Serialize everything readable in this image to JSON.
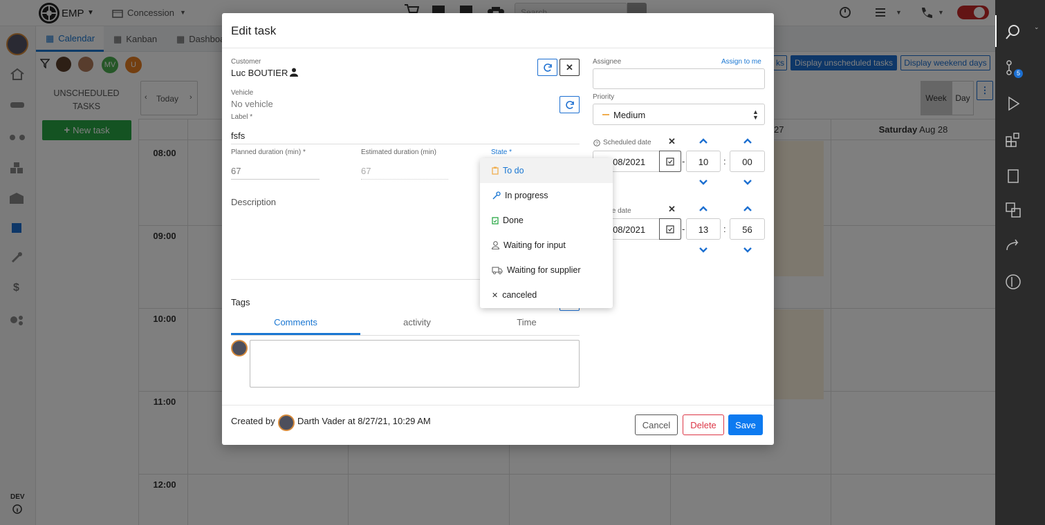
{
  "topbar": {
    "app_name": "EMP",
    "location": "Concession",
    "search_placeholder": "Search"
  },
  "view_tabs": [
    {
      "label": "Calendar",
      "icon": "calendar-icon"
    },
    {
      "label": "Kanban",
      "icon": "kanban-icon"
    },
    {
      "label": "Dashboa",
      "icon": "dashboard-icon"
    }
  ],
  "filter_avatars": [
    "MV",
    "U"
  ],
  "avatar_colors": {
    "MV": "#4caf50",
    "U": "#e67e22"
  },
  "unscheduled": {
    "title": "UNSCHEDULED TASKS",
    "new_task_label": "New task"
  },
  "nav": {
    "today": "Today",
    "week": "Week",
    "day": "Day"
  },
  "toolbar_buttons": {
    "tasks_fragment": "ks",
    "display_unscheduled": "Display unscheduled tasks",
    "display_weekend": "Display weekend days"
  },
  "calendar": {
    "day_header_fragment": "27",
    "saturday_label": "Saturday",
    "saturday_date": "Aug 28",
    "hours": [
      "08:00",
      "09:00",
      "10:00",
      "11:00",
      "12:00"
    ]
  },
  "sidebar_footer": {
    "env": "DEV"
  },
  "modal": {
    "title": "Edit task",
    "customer_label": "Customer",
    "customer_value": "Luc BOUTIER",
    "vehicle_label": "Vehicle",
    "vehicle_value": "No vehicle",
    "label_label": "Label *",
    "label_value": "fsfs",
    "planned_label": "Planned duration (min) *",
    "planned_value": "67",
    "estimated_label": "Estimated duration (min)",
    "estimated_value": "67",
    "state_label": "State *",
    "description_label": "Description",
    "tags_label": "Tags",
    "comment_tabs": [
      "Comments",
      "activity",
      "Time"
    ],
    "assignee_label": "Assignee",
    "assign_to_me": "Assign to me",
    "priority_label": "Priority",
    "priority_value": "Medium",
    "scheduled_label": "Scheduled date",
    "scheduled_date": "27/08/2021",
    "scheduled_hour": "10",
    "scheduled_minute": "00",
    "due_label": "Due date",
    "due_date": "27/08/2021",
    "due_hour": "13",
    "due_minute": "56",
    "created_by_prefix": "Created by",
    "created_by_name": "Darth Vader at 8/27/21, 10:29 AM",
    "cancel": "Cancel",
    "delete": "Delete",
    "save": "Save"
  },
  "state_options": [
    {
      "label": "To do",
      "icon": "clipboard-icon",
      "color": "#f0ad4e",
      "selected": true
    },
    {
      "label": "In progress",
      "icon": "wrench-icon",
      "color": "#1976d2",
      "selected": false
    },
    {
      "label": "Done",
      "icon": "clipboard-check-icon",
      "color": "#28a745",
      "selected": false
    },
    {
      "label": "Waiting for input",
      "icon": "user-icon",
      "color": "#666666",
      "selected": false
    },
    {
      "label": "Waiting for supplier",
      "icon": "truck-icon",
      "color": "#666666",
      "selected": false
    },
    {
      "label": "canceled",
      "icon": "close-icon",
      "color": "#333333",
      "selected": false
    }
  ],
  "colors": {
    "primary": "#1c6fd1",
    "danger": "#dc3545",
    "sidebar_dark": "#2b2b2b"
  },
  "right_sidebar_badge": "5"
}
